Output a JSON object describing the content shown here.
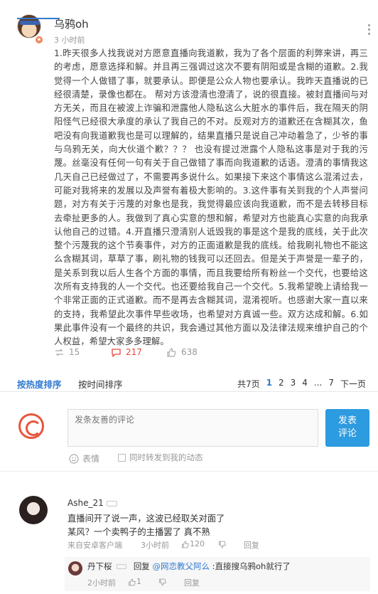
{
  "post": {
    "username": "乌鸦oh",
    "time": "3 小时前",
    "body": "1.昨天很多人找我说对方愿意直播向我道歉，我为了各个层面的利弊来讲，再三的考虑，愿意选择和解。并且再三强调过这次不要有阴阳或是含糊的道歉。2.我觉得一个人做错了事，就要承认。即便是公众人物也要承认。我昨天直播说的已经很清楚，录像也都在。 帮对方该澄清也澄清了，说的很直接。被封直播间与对方无关，而且在被波上诈骗和泄露他人隐私这么大脏水的事件后，我在隔天的阴阳怪气已经很大承度的承认了我自己的不对。反观对方的道歉还在含糊其次，鱼吧没有向我道歉我也是可以理解的，结果直播只是说自己冲动着急了，少爷的事与乌鸦无关，向大伙道个歉？？？ 也没有提过泄露个人隐私这事是对于我的污蔑。丝毫没有任何一句有关于自己做错了事而向我道歉的话语。澄清的事情我这几天自己已经做过了，不需要再多说什么。如果接下来这个事情这么混淆过去，可能对我将来的发展以及声誉有着极大影响的。3.这件事有关到我的个人声誉问题，对方有关于污蔑的对象也是我，我觉得最应该向我道歉，而不是去转移目标去牵扯更多的人。我做到了真心实意的想和解，希望对方也能真心实意的向我承认他自己的过错。4.开直播只澄清别人诋毁我的事是这个是我的底线，关于此次整个污蔑我的这个节奏事件，对方的正面道歉是我的底线。给我刷礼物也不能这么含糊其词，草草了事，刷礼物的钱我可以还回去。但是关于声誉是一辈子的，是关系到我以后人生各个方面的事情，而且我要给所有粉丝一个交代，也要给这次所有支持我的人一个交代。也还要给我自己一个交代。5.我希望晚上请给我一个非常正面的正式道歉。而不是再去含糊其词，混淆视听。也感谢大家一直以来的支持，我希望此次事件早些收场，也希望对方真诚一些。双方达成和解。6.如果此事件没有一个最终的共识，我会通过其他方面以及法律法规来维护自己的个人权益，希望大家多多理解。",
    "repost_count": "15",
    "comment_count": "217",
    "like_count": "638"
  },
  "sort": {
    "tab_hot": "按热度排序",
    "tab_time": "按时间排序",
    "pager": {
      "total": "共7页",
      "pages": [
        "1",
        "2",
        "3",
        "4"
      ],
      "ellipsis": "...",
      "last": "7",
      "next": "下一页"
    }
  },
  "composer": {
    "placeholder": "发条友善的评论",
    "submit": "发表\n评论",
    "emoji_label": "表情",
    "repost_label": "同时转发到我的动态"
  },
  "comments": [
    {
      "username": "Ashe_21",
      "text": "直播间开了说一声，这波已经取关对面了\n某风？一个卖鸭子的主播罢了 真不熟",
      "source": "来自安卓客户端",
      "time": "3小时前",
      "likes": "120",
      "reply_label": "回复",
      "replies": [
        {
          "username": "丹下桜",
          "prefix": "回复",
          "mention": "@网恋教父阿么",
          "text": ":直接搜乌鸦oh就行了",
          "time": "2小时前",
          "likes": "1",
          "reply_label": "回复"
        }
      ]
    }
  ],
  "colors": {
    "accent": "#2f7bd0",
    "comment_red": "#e8483c",
    "submit_blue": "#2c9be0",
    "logo_orange": "#e8553b"
  }
}
